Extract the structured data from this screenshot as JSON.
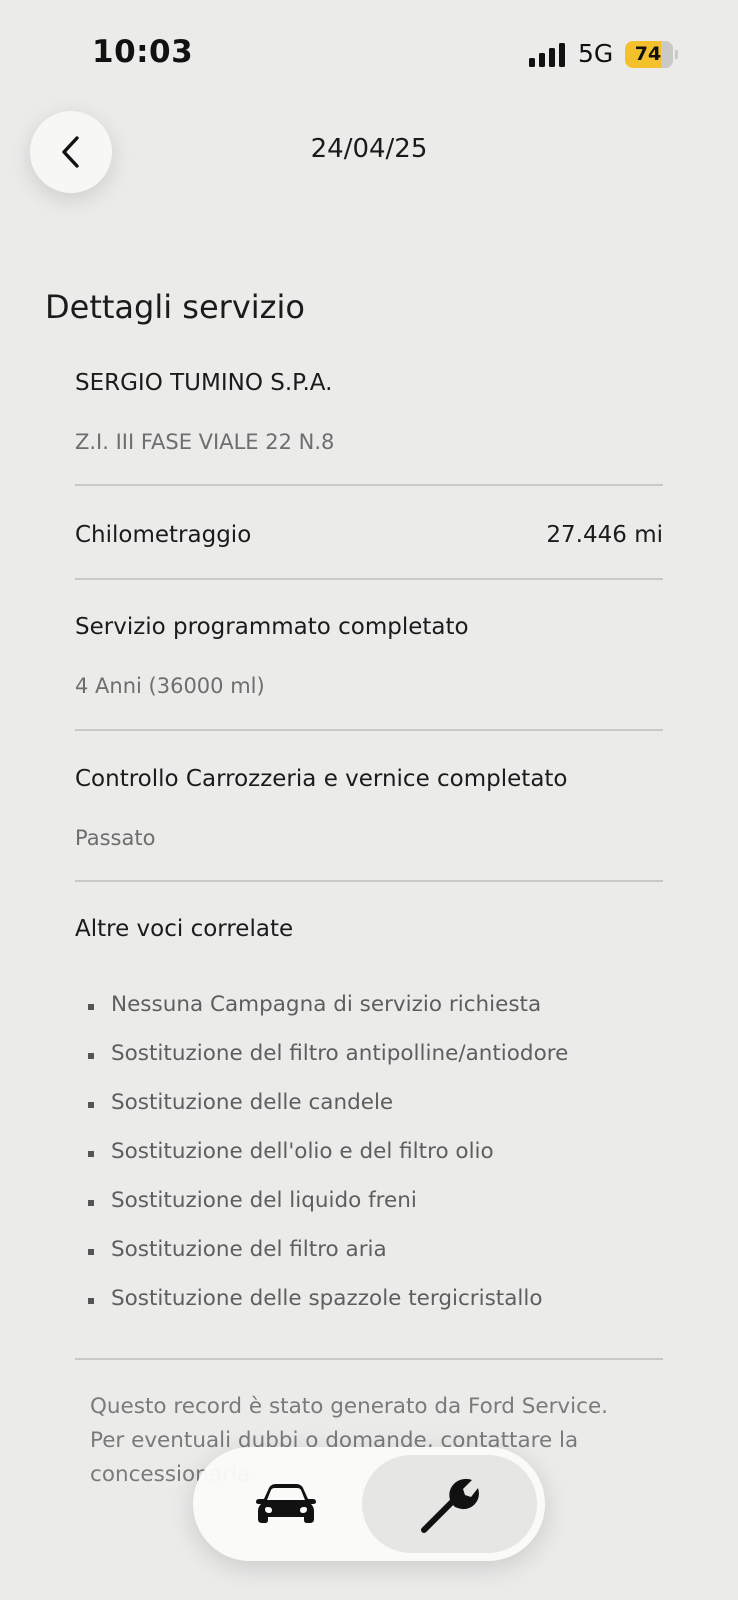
{
  "status_bar": {
    "time": "10:03",
    "network": "5G",
    "battery": "74",
    "battery_level": 0.74,
    "battery_color": "#f4c02b",
    "signal_icon": "cellular-signal-icon"
  },
  "header": {
    "back_icon": "chevron-left-icon",
    "date": "24/04/25"
  },
  "section": {
    "title": "Dettagli servizio"
  },
  "dealer": {
    "name": "SERGIO TUMINO S.P.A.",
    "address": "Z.I. III FASE VIALE 22 N.8"
  },
  "mileage": {
    "label": "Chilometraggio",
    "value": "27.446 mi"
  },
  "scheduled_service": {
    "label": "Servizio programmato completato",
    "value": "4 Anni (36000 ml)"
  },
  "body_check": {
    "label": "Controllo Carrozzeria e vernice completato",
    "value": "Passato"
  },
  "related": {
    "label": "Altre voci correlate",
    "items": [
      "Nessuna Campagna di servizio richiesta",
      "Sostituzione del filtro antipolline/antiodore",
      "Sostituzione delle candele",
      "Sostituzione dell'olio e del filtro olio",
      "Sostituzione del liquido freni",
      "Sostituzione del filtro aria",
      "Sostituzione delle spazzole tergicristallo"
    ]
  },
  "footer": {
    "line1": "Questo record è stato generato da Ford Service.",
    "line2": "Per eventuali dubbi o domande, contattare la",
    "line3": "concessionaria."
  },
  "bottom_nav": {
    "items": [
      {
        "icon": "car-icon",
        "selected": false
      },
      {
        "icon": "wrench-icon",
        "selected": true
      }
    ]
  }
}
